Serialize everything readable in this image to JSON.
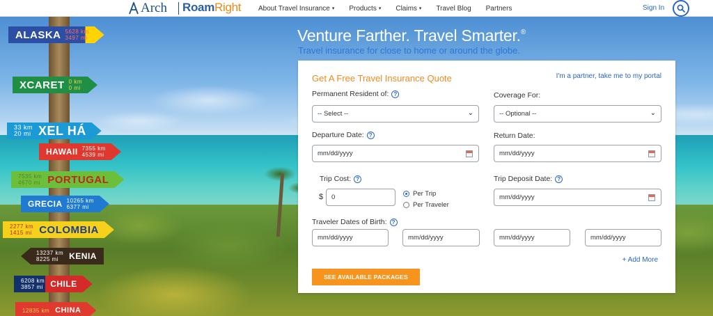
{
  "brand": {
    "arch_name": "Arch",
    "roam_part1": "Roam",
    "roam_part2": "Right",
    "colors": {
      "primary": "#2b66c4",
      "accent": "#f7941d",
      "title_orange": "#ef8a20"
    }
  },
  "nav": {
    "items": [
      {
        "label": "About Travel Insurance",
        "has_caret": true
      },
      {
        "label": "Products",
        "has_caret": true
      },
      {
        "label": "Claims",
        "has_caret": true
      },
      {
        "label": "Travel Blog",
        "has_caret": false
      },
      {
        "label": "Partners",
        "has_caret": false
      }
    ],
    "caret": "▾",
    "sign_in": "Sign In",
    "search_icon": "search-icon"
  },
  "signs": {
    "alaska": {
      "name": "ALASKA",
      "d1": "5628 km",
      "d2": "3497 mi"
    },
    "xcaret": {
      "name": "XCARET",
      "d1": "0 km",
      "d2": "0 mi"
    },
    "xelha": {
      "name": "XEL HÁ",
      "d1": "33 km",
      "d2": "20 mi"
    },
    "hawaii": {
      "name": "HAWAII",
      "d1": "7355 km",
      "d2": "4539 mi"
    },
    "portugal": {
      "name": "PORTUGAL",
      "d1": "7535 km",
      "d2": "4670 mi"
    },
    "grecia": {
      "name": "GRECIA",
      "d1": "10265 km",
      "d2": "6377 mi"
    },
    "colombia": {
      "name": "COLOMBIA",
      "d1": "2277 km",
      "d2": "1415 mi"
    },
    "kenia": {
      "name": "KENIA",
      "d1": "13237 km",
      "d2": "8225 mi"
    },
    "chile": {
      "name": "CHILE",
      "d1": "6208 km",
      "d2": "3857 mi"
    },
    "china": {
      "name": "CHINA",
      "d1": "12835 km",
      "d2": ""
    }
  },
  "hero": {
    "title": "Venture Farther. Travel Smarter.",
    "title_mark": "®",
    "subtitle": "Travel insurance for close to home or around the globe."
  },
  "quote_form": {
    "title": "Get A Free Travel Insurance Quote",
    "partner_link": "I'm a partner, take me to my portal",
    "help_glyph": "?",
    "residence": {
      "label": "Permanent Resident of:",
      "value": "-- Select --"
    },
    "coverage": {
      "label": "Coverage For:",
      "value": "-- Optional --"
    },
    "departure": {
      "label": "Departure Date:",
      "placeholder": "mm/dd/yyyy"
    },
    "return": {
      "label": "Return Date:",
      "placeholder": "mm/dd/yyyy"
    },
    "trip_cost": {
      "label": "Trip Cost:",
      "currency": "$",
      "value": "0"
    },
    "cost_basis": {
      "per_trip": "Per Trip",
      "per_traveler": "Per Traveler",
      "selected": "Per Trip"
    },
    "deposit": {
      "label": "Trip Deposit Date:",
      "placeholder": "mm/dd/yyyy"
    },
    "birthdates": {
      "label": "Traveler Dates of Birth:",
      "fields": [
        "mm/dd/yyyy",
        "mm/dd/yyyy",
        "mm/dd/yyyy",
        "mm/dd/yyyy"
      ]
    },
    "add_more": "+ Add More",
    "submit": "SEE AVAILABLE PACKAGES",
    "chevron": "⌄"
  }
}
